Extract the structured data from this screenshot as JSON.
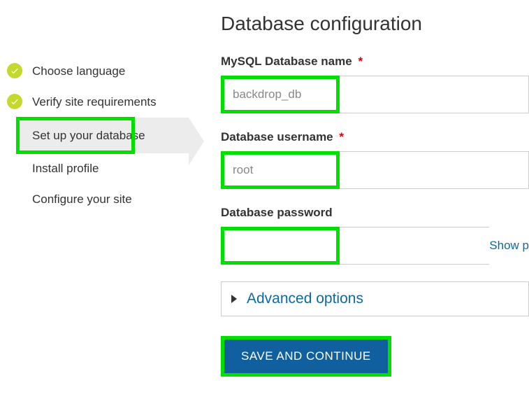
{
  "heading": "Database configuration",
  "steps": {
    "choose_language": "Choose language",
    "verify_requirements": "Verify site requirements",
    "setup_database": "Set up your database",
    "install_profile": "Install profile",
    "configure_site": "Configure your site"
  },
  "labels": {
    "db_name": "MySQL Database name",
    "db_user": "Database username",
    "db_pass": "Database password"
  },
  "values": {
    "db_name": "backdrop_db",
    "db_user": "root",
    "db_pass": ""
  },
  "required_mark": "*",
  "show_password": "Show p",
  "advanced": "Advanced options",
  "save": "SAVE AND CONTINUE"
}
